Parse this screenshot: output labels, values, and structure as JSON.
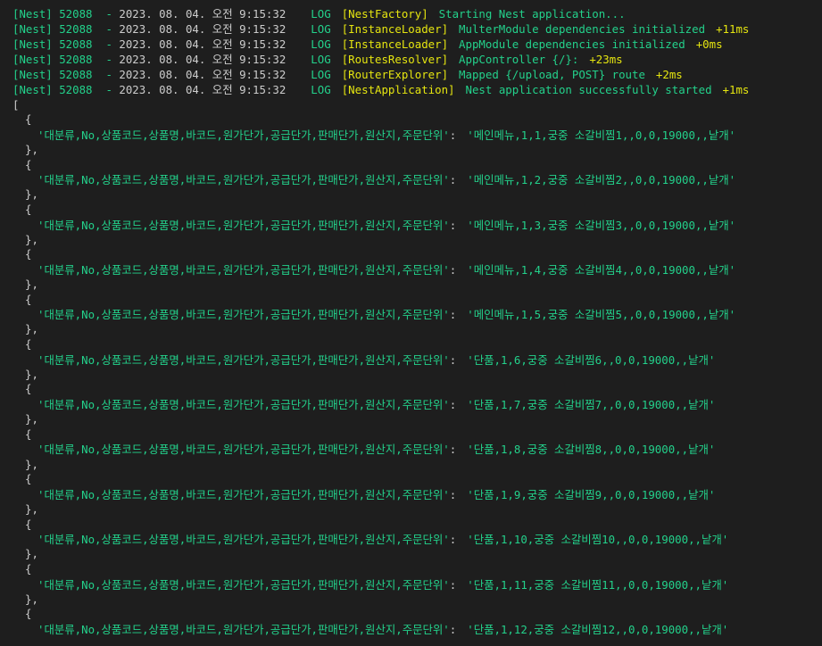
{
  "window": {
    "background": "#1e1e1e"
  },
  "colors": {
    "nest_green": "#23d18b",
    "context_yellow": "#e5e510",
    "default_text": "#cccccc"
  },
  "log_lines": [
    {
      "prefix": "[Nest] 52088",
      "sep": "  - ",
      "date": "2023. 08. 04. 오전 9:15:32",
      "level": "LOG",
      "context": "[NestFactory]",
      "message": "Starting Nest application...",
      "ms": ""
    },
    {
      "prefix": "[Nest] 52088",
      "sep": "  - ",
      "date": "2023. 08. 04. 오전 9:15:32",
      "level": "LOG",
      "context": "[InstanceLoader]",
      "message": "MulterModule dependencies initialized",
      "ms": "+11ms"
    },
    {
      "prefix": "[Nest] 52088",
      "sep": "  - ",
      "date": "2023. 08. 04. 오전 9:15:32",
      "level": "LOG",
      "context": "[InstanceLoader]",
      "message": "AppModule dependencies initialized",
      "ms": "+0ms"
    },
    {
      "prefix": "[Nest] 52088",
      "sep": "  - ",
      "date": "2023. 08. 04. 오전 9:15:32",
      "level": "LOG",
      "context": "[RoutesResolver]",
      "message": "AppController {/}:",
      "ms": "+23ms"
    },
    {
      "prefix": "[Nest] 52088",
      "sep": "  - ",
      "date": "2023. 08. 04. 오전 9:15:32",
      "level": "LOG",
      "context": "[RouterExplorer]",
      "message": "Mapped {/upload, POST} route",
      "ms": "+2ms"
    },
    {
      "prefix": "[Nest] 52088",
      "sep": "  - ",
      "date": "2023. 08. 04. 오전 9:15:32",
      "level": "LOG",
      "context": "[NestApplication]",
      "message": "Nest application successfully started",
      "ms": "+1ms"
    }
  ],
  "dump": {
    "open_bracket": "[",
    "open_brace": "{",
    "close_brace": "},",
    "key": "'대분류,No,상품코드,상품명,바코드,원가단가,공급단가,판매단가,원산지,주문단위'",
    "colon": ":",
    "entries": [
      "'메인메뉴,1,1,궁중 소갈비찜1,,0,0,19000,,낱개'",
      "'메인메뉴,1,2,궁중 소갈비찜2,,0,0,19000,,낱개'",
      "'메인메뉴,1,3,궁중 소갈비찜3,,0,0,19000,,낱개'",
      "'메인메뉴,1,4,궁중 소갈비찜4,,0,0,19000,,낱개'",
      "'메인메뉴,1,5,궁중 소갈비찜5,,0,0,19000,,낱개'",
      "'단품,1,6,궁중 소갈비찜6,,0,0,19000,,낱개'",
      "'단품,1,7,궁중 소갈비찜7,,0,0,19000,,낱개'",
      "'단품,1,8,궁중 소갈비찜8,,0,0,19000,,낱개'",
      "'단품,1,9,궁중 소갈비찜9,,0,0,19000,,낱개'",
      "'단품,1,10,궁중 소갈비찜10,,0,0,19000,,낱개'",
      "'단품,1,11,궁중 소갈비찜11,,0,0,19000,,낱개'",
      "'단품,1,12,궁중 소갈비찜12,,0,0,19000,,낱개'"
    ]
  }
}
